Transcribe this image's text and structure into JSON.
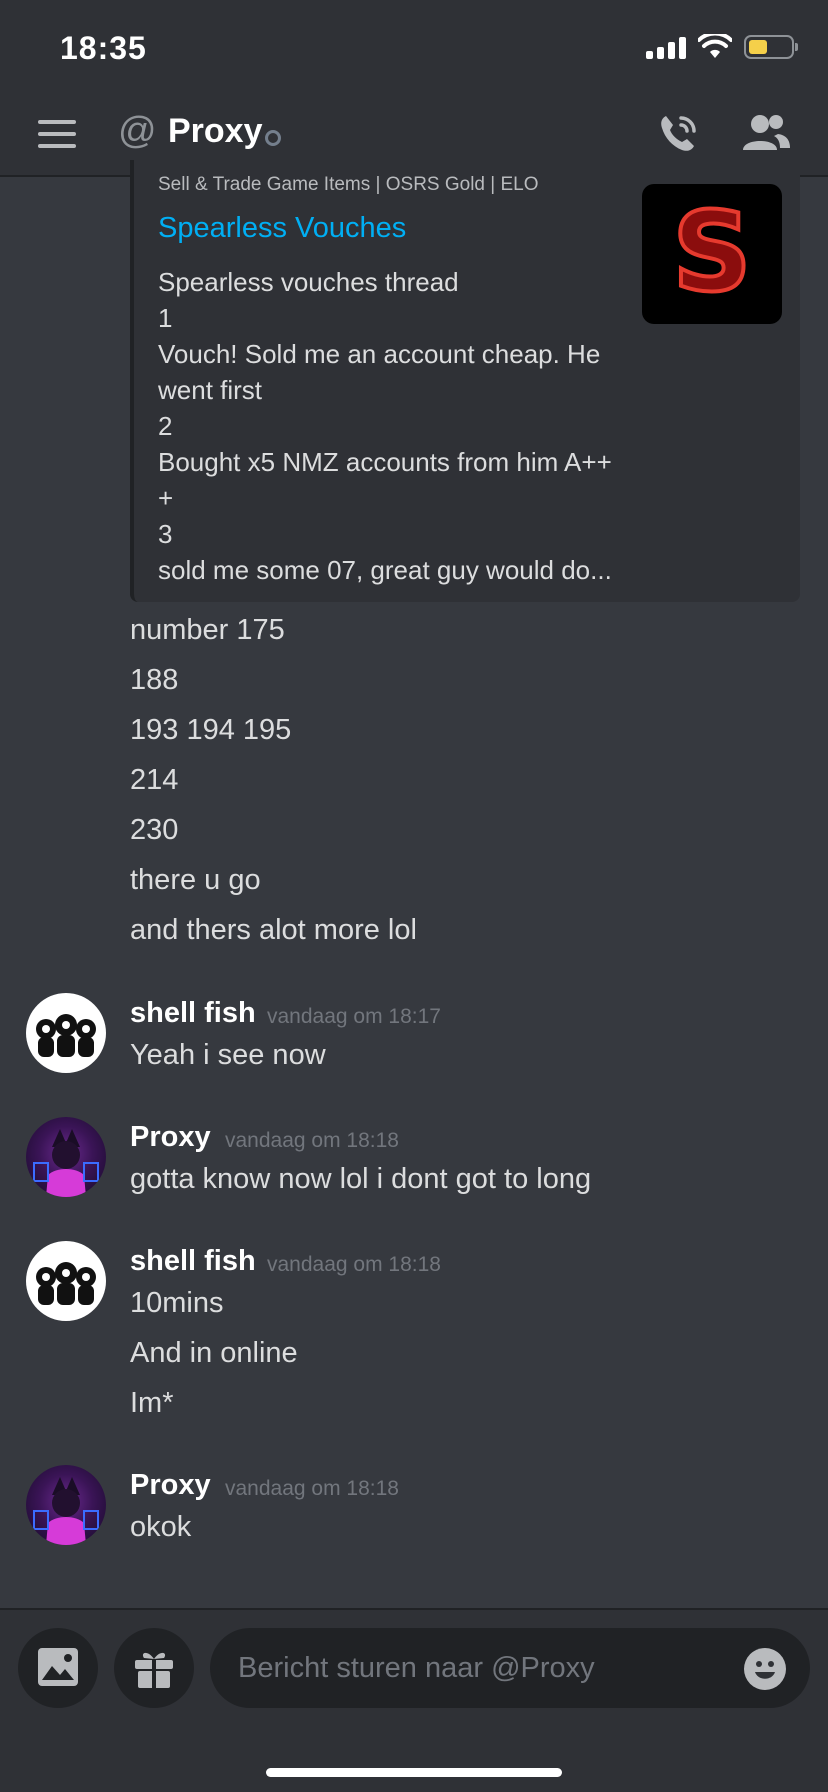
{
  "status_bar": {
    "time": "18:35"
  },
  "header": {
    "at_symbol": "@",
    "name": "Proxy",
    "icons": [
      "hamburger-menu-icon",
      "phone-call-icon",
      "members-icon"
    ]
  },
  "embed": {
    "provider": "Sell & Trade Game Items | OSRS Gold | ELO",
    "title": "Spearless Vouches",
    "description_lines": [
      "Spearless vouches thread",
      "1",
      "Vouch! Sold me an account cheap. He",
      "went first",
      "2",
      "Bought x5 NMZ accounts from him A++",
      "+",
      "3",
      "sold me some 07, great guy would do..."
    ],
    "thumbnail_letter": "S"
  },
  "continuation_lines": [
    "number 175",
    "188",
    "193 194 195",
    "214",
    "230",
    "there u go",
    "and thers alot more lol"
  ],
  "messages": [
    {
      "author": "shell fish",
      "time": "vandaag om 18:17",
      "lines": [
        "Yeah i see now"
      ]
    },
    {
      "author": "Proxy",
      "time": "vandaag om 18:18",
      "lines": [
        "gotta know now lol i dont got to long"
      ]
    },
    {
      "author": "shell fish",
      "time": "vandaag om 18:18",
      "lines": [
        "10mins",
        "And in online",
        "Im*"
      ]
    },
    {
      "author": "Proxy",
      "time": "vandaag om 18:18",
      "lines": [
        "okok"
      ]
    }
  ],
  "composer": {
    "placeholder": "Bericht sturen naar @Proxy",
    "icons": [
      "image-upload-icon",
      "gift-icon",
      "emoji-icon"
    ]
  },
  "colors": {
    "background": "#36393f",
    "bar": "#2f3136",
    "link": "#00aff4",
    "muted": "#72767d",
    "battery": "#f5d04a"
  }
}
